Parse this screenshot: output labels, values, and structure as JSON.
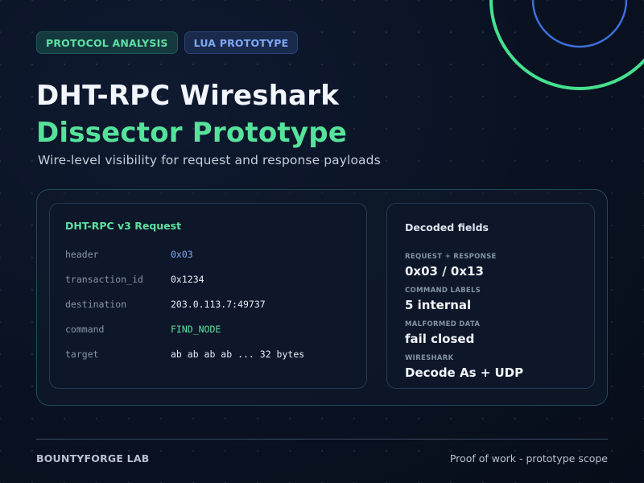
{
  "tags": [
    "PROTOCOL ANALYSIS",
    "LUA PROTOTYPE"
  ],
  "title": {
    "line1": "DHT-RPC Wireshark",
    "line2": "Dissector Prototype"
  },
  "subtitle": "Wire-level visibility for request and response payloads",
  "request_panel": {
    "title": "DHT-RPC v3 Request",
    "rows": [
      {
        "key": "header",
        "value": "0x03"
      },
      {
        "key": "transaction_id",
        "value": "0x1234"
      },
      {
        "key": "destination",
        "value": "203.0.113.7:49737"
      },
      {
        "key": "command",
        "value": "FIND_NODE"
      },
      {
        "key": "target",
        "value": "ab ab ab ab ... 32 bytes"
      }
    ]
  },
  "decoded_panel": {
    "title": "Decoded fields",
    "fields": [
      {
        "label": "REQUEST + RESPONSE",
        "value": "0x03 / 0x13"
      },
      {
        "label": "COMMAND LABELS",
        "value": "5 internal"
      },
      {
        "label": "MALFORMED DATA",
        "value": "fail closed"
      },
      {
        "label": "WIRESHARK",
        "value": "Decode As + UDP"
      }
    ]
  },
  "footer": {
    "left": "BOUNTYFORGE LAB",
    "right": "Proof of work - prototype scope"
  },
  "colors": {
    "accent_green": "#55e39b",
    "accent_blue": "#7fa8f4",
    "background": "#0a1222"
  }
}
